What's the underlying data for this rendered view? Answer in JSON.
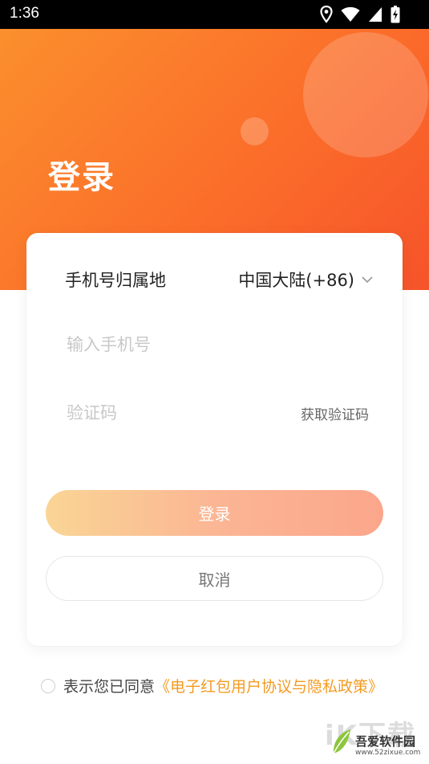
{
  "status_bar": {
    "time": "1:36",
    "icons": [
      "location-icon",
      "wifi-icon",
      "signal-icon",
      "battery-charging-icon"
    ]
  },
  "hero": {
    "title": "登录",
    "gradient_start": "#fb8f2d",
    "gradient_end": "#f6532a"
  },
  "form": {
    "region_label": "手机号归属地",
    "region_value": "中国大陆(+86)",
    "phone_placeholder": "输入手机号",
    "code_placeholder": "验证码",
    "get_code_label": "获取验证码",
    "login_label": "登录",
    "cancel_label": "取消"
  },
  "agreement": {
    "prefix": "表示您已同意",
    "link": "《电子红包用户协议与隐私政策》",
    "link_color": "#f39b22",
    "checked": false
  },
  "watermark": {
    "logo_text": "iK下载",
    "site_name": "吾爱软件园",
    "url": "www.52zixue.com"
  }
}
